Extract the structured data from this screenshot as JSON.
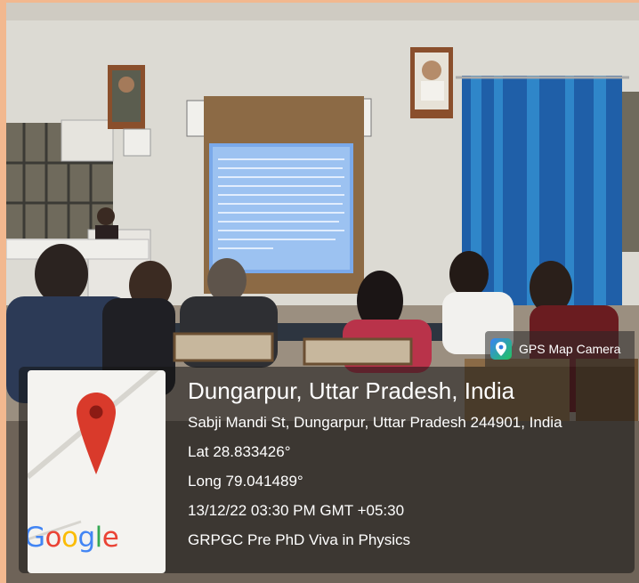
{
  "photo": {
    "description_icon": "classroom-photo"
  },
  "app_badge": {
    "icon": "gps-map-camera-icon",
    "label": "GPS Map Camera"
  },
  "location": {
    "place": "Dungarpur, Uttar Pradesh, India",
    "address": "Sabji Mandi St, Dungarpur, Uttar Pradesh 244901, India",
    "lat": "Lat 28.833426°",
    "long": "Long 79.041489°",
    "datetime": "13/12/22 03:30 PM GMT +05:30",
    "note": "GRPGC Pre PhD Viva in Physics"
  },
  "map": {
    "pin_icon": "map-pin-icon",
    "logo_text": "Google"
  },
  "colors": {
    "border": "#f2b88f",
    "curtain": "#1f5fa8",
    "pin": "#d93a2b"
  }
}
